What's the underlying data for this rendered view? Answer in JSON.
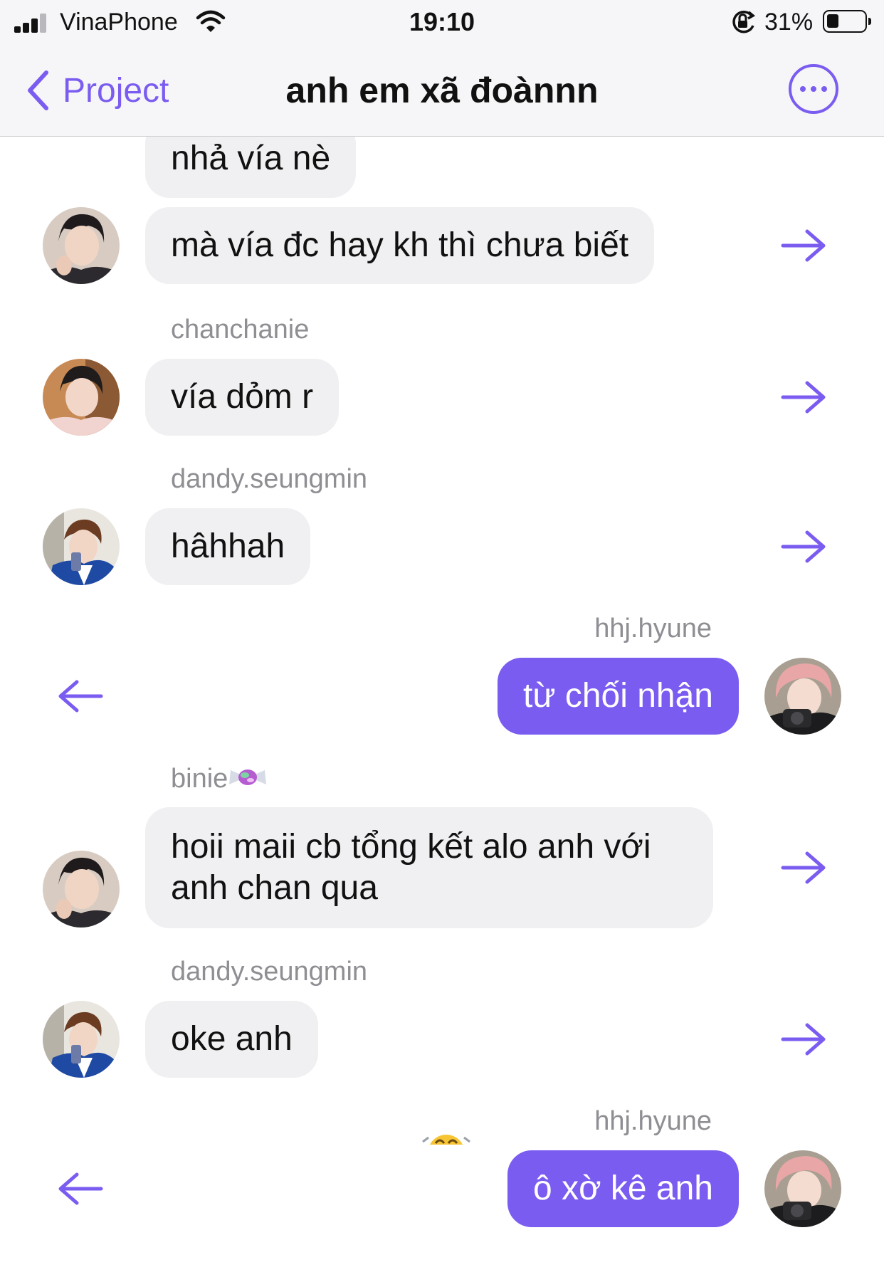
{
  "status_bar": {
    "carrier": "VinaPhone",
    "time": "19:10",
    "battery_percent": "31%"
  },
  "nav": {
    "back_label": "Project",
    "title": "anh em xã đoànnn",
    "icons": {
      "back": "chevron-left-icon",
      "more": "more-options-icon"
    }
  },
  "colors": {
    "accent": "#7b5cf0",
    "incoming_bubble": "#f0f0f2",
    "sender_name": "#8e8e93"
  },
  "messages": [
    {
      "direction": "in",
      "text": "nhả vía nè"
    },
    {
      "direction": "in",
      "text": "mà vía đc hay kh thì chưa biết"
    },
    {
      "direction": "in",
      "sender": "chanchanie",
      "text": "vía dỏm r"
    },
    {
      "direction": "in",
      "sender": "dandy.seungmin",
      "text": "hâhhah"
    },
    {
      "direction": "out",
      "sender": "hhj.hyune",
      "text": "từ chối nhận"
    },
    {
      "direction": "in",
      "sender": "binie",
      "sender_emoji": "candy",
      "text": "hoii maii cb tổng kết alo anh với anh chan qua"
    },
    {
      "direction": "in",
      "sender": "dandy.seungmin",
      "text": "oke anh"
    },
    {
      "direction": "out",
      "sender": "hhj.hyune",
      "text": "ô xờ kê anh"
    }
  ]
}
